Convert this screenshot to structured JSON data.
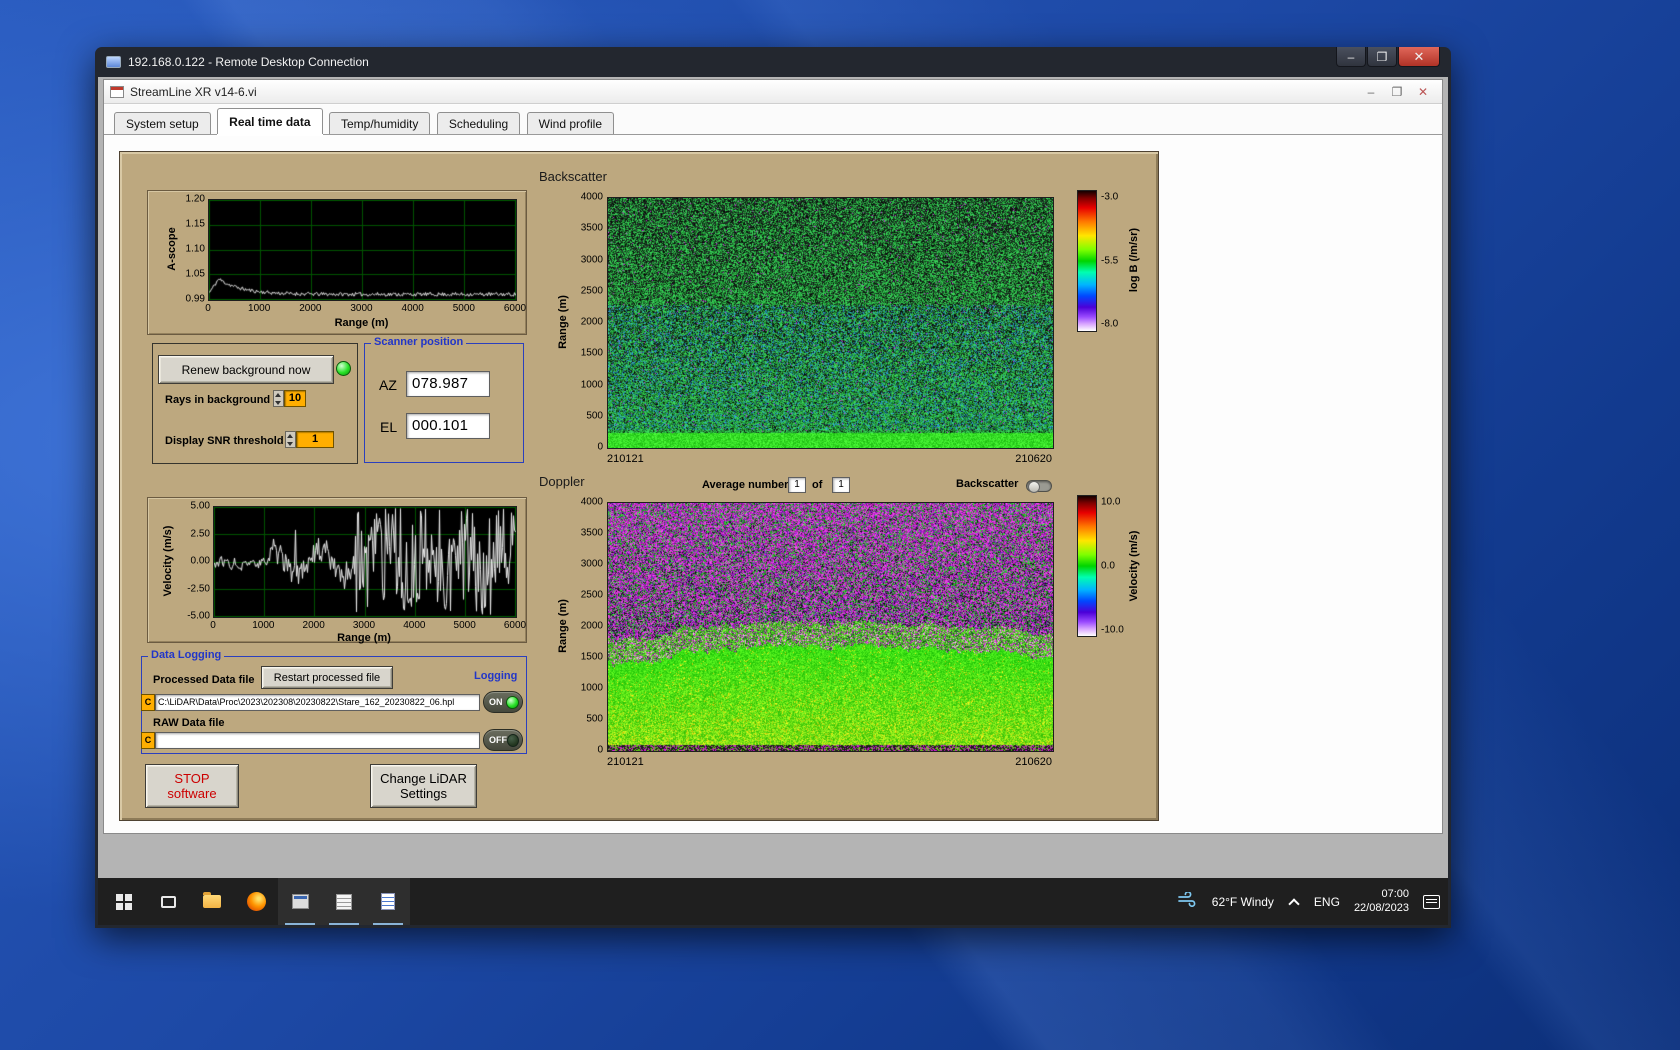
{
  "rdp_window": {
    "title": "192.168.0.122 - Remote Desktop Connection",
    "controls": {
      "minimize": "–",
      "maximize": "❐",
      "close": "✕"
    }
  },
  "app_window": {
    "title": "StreamLine XR v14-6.vi",
    "controls": {
      "minimize": "–",
      "restore": "❐",
      "close": "✕"
    }
  },
  "tabs": [
    {
      "label": "System setup",
      "active": false
    },
    {
      "label": "Real time data",
      "active": true
    },
    {
      "label": "Temp/humidity",
      "active": false
    },
    {
      "label": "Scheduling",
      "active": false
    },
    {
      "label": "Wind profile",
      "active": false
    }
  ],
  "background_ctrl": {
    "renew_button": "Renew background now",
    "rays_label": "Rays in background",
    "rays_value": "10",
    "snr_label": "Display SNR threshold",
    "snr_value": "1"
  },
  "scanner": {
    "title": "Scanner position",
    "az_label": "AZ",
    "az_value": "078.987",
    "el_label": "EL",
    "el_value": "000.101"
  },
  "data_logging": {
    "title": "Data Logging",
    "processed_label": "Processed Data file",
    "restart_button": "Restart processed file",
    "logging_label": "Logging",
    "drive_letter": "C",
    "processed_path": "C:\\LiDAR\\Data\\Proc\\2023\\202308\\20230822\\Stare_162_20230822_06.hpl",
    "raw_label": "RAW Data file",
    "raw_path": "",
    "on_label": "ON",
    "off_label": "OFF"
  },
  "actions": {
    "stop_line1": "STOP",
    "stop_line2": "software",
    "settings_line1": "Change LiDAR",
    "settings_line2": "Settings"
  },
  "doppler_controls": {
    "avg_label": "Average number",
    "avg_value": "1",
    "of_label": "of",
    "of_count": "1",
    "toggle_label": "Backscatter"
  },
  "taskbar": {
    "icons": [
      "start",
      "task-view",
      "file-explorer",
      "firefox",
      "streamline-app",
      "scan-scheduler",
      "document-app"
    ],
    "weather": "62°F Windy",
    "language": "ENG",
    "time": "07:00",
    "date": "22/08/2023"
  },
  "colors": {
    "panel_tan": "#bda87f",
    "group_label_blue": "#2236c8",
    "value_field_orange": "#ffae00",
    "stop_red": "#cc0000",
    "led_green": "#27e227"
  },
  "chart_data": [
    {
      "id": "ascope",
      "type": "line",
      "ylabel": "A-scope",
      "xlabel": "Range (m)",
      "ylim": [
        0.99,
        1.2
      ],
      "xlim": [
        0,
        6000
      ],
      "yticks": [
        "1.20",
        "1.15",
        "1.10",
        "1.05",
        "0.99"
      ],
      "xticks": [
        "0",
        "1000",
        "2000",
        "3000",
        "4000",
        "5000",
        "6000"
      ],
      "grid": true,
      "trace": {
        "baseline": 1.0,
        "peak_x": 180,
        "peak_value": 1.033,
        "decay": 450,
        "noise": 0.004
      },
      "note": "white noisy trace near 1.00 with small peak ~1.03 below 500 m, flat to 6000 m"
    },
    {
      "id": "velocity",
      "type": "line",
      "ylabel": "Velocity (m/s)",
      "xlabel": "Range (m)",
      "ylim": [
        -5,
        5
      ],
      "xlim": [
        0,
        6000
      ],
      "yticks": [
        "5.00",
        "2.50",
        "0.00",
        "-2.50",
        "-5.00"
      ],
      "xticks": [
        "0",
        "1000",
        "2000",
        "3000",
        "4000",
        "5000",
        "6000"
      ],
      "grid": true,
      "segments": [
        {
          "from": 0,
          "to": 1100,
          "amplitude": 0.5
        },
        {
          "from": 1100,
          "to": 2800,
          "amplitude": 3.0
        },
        {
          "from": 2800,
          "to": 6000,
          "amplitude": 5.0
        }
      ],
      "note": "quiet near 0 below 1100 m, coherent gusts to ±3.5 m/s 1100-2800 m, saturated full-range noise beyond"
    },
    {
      "id": "backscatter",
      "type": "heatmap",
      "title": "Backscatter",
      "ylabel": "Range (m)",
      "ylim": [
        0,
        4000
      ],
      "yticks": [
        "4000",
        "3500",
        "3000",
        "2500",
        "2000",
        "1500",
        "1000",
        "500",
        "0"
      ],
      "time_start": "210121",
      "time_end": "210620",
      "colorbar": {
        "label": "log B (/m/sr)",
        "ticks": [
          "-3.0",
          "-5.5",
          "-8.0"
        ],
        "range": [
          -3.0,
          -8.0
        ]
      },
      "pattern": "speckled green noise, dark speckle density increasing with altitude, teal-blue patches 300-2300 m, solid bright green layer below ~250 m"
    },
    {
      "id": "doppler",
      "type": "heatmap",
      "title": "Doppler",
      "ylabel": "Range (m)",
      "ylim": [
        0,
        4000
      ],
      "yticks": [
        "4000",
        "3500",
        "3000",
        "2500",
        "2000",
        "1500",
        "1000",
        "500",
        "0"
      ],
      "time_start": "210121",
      "time_end": "210620",
      "colorbar": {
        "label": "Velocity (m/s)",
        "ticks": [
          "10.0",
          "0.0",
          "-10.0"
        ],
        "range": [
          10,
          -10
        ]
      },
      "boundary_m": [
        1450,
        1700,
        1500
      ],
      "pattern": "magenta/purple and green random speckle aloft, bright green-yellow boundary layer below ~1500-1700 m, thin dark/magenta stripe at ground"
    }
  ]
}
